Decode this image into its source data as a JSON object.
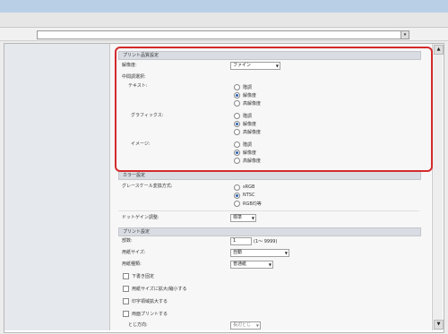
{
  "address": {
    "value": "",
    "dropdown_icon": "▾"
  },
  "sections": {
    "print_quality": {
      "header": "プリント品質設定",
      "resolution_label": "解像度:",
      "resolution_value": "ファイン",
      "halftone_label": "中間調選択:",
      "text_label": "テキスト:",
      "graphics_label": "グラフィックス:",
      "image_label": "イメージ:",
      "options": [
        "階調",
        "解像度",
        "高解像度"
      ],
      "text_selected": 1,
      "graphics_selected": 1,
      "image_selected": 1
    },
    "color": {
      "header": "カラー設定",
      "grayscale_label": "グレースケール変換方式:",
      "grayscale_options": [
        "sRGB",
        "NTSC",
        "RGB均等"
      ],
      "grayscale_selected": 1,
      "dot_label": "ドットゲイン調整:",
      "dot_value": "標準"
    },
    "print": {
      "header": "プリント設定",
      "copies_label": "部数:",
      "copies_value": "1",
      "copies_range": "(1〜 9999)",
      "paper_size_label": "用紙サイズ:",
      "paper_size_value": "自動",
      "paper_type_label": "用紙種類:",
      "paper_type_value": "普通紙",
      "check_draft": "下書き固定",
      "check_fit": "用紙サイズに拡大/縮小する",
      "check_fit_printable": "印字領域拡大する",
      "check_duplex": "両面プリントする",
      "binding_label": "とじ方向:",
      "binding_value": "長辺とじ"
    }
  },
  "colors": {
    "highlight": "#d42b2b",
    "radio_on": "#2a5fb0"
  }
}
